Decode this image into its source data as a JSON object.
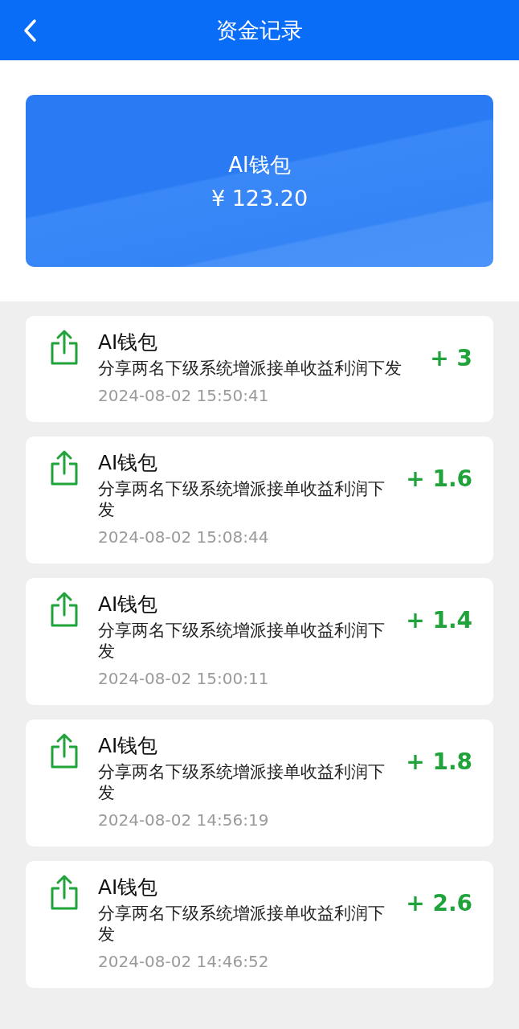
{
  "header": {
    "title": "资金记录"
  },
  "wallet": {
    "name": "AI钱包",
    "balance": "¥ 123.20"
  },
  "records": [
    {
      "name": "AI钱包",
      "description": "分享两名下级系统增派接单收益利润下发",
      "amount": "+ 3",
      "time": "2024-08-02 15:50:41"
    },
    {
      "name": "AI钱包",
      "description": "分享两名下级系统增派接单收益利润下发",
      "amount": "+ 1.6",
      "time": "2024-08-02 15:08:44"
    },
    {
      "name": "AI钱包",
      "description": "分享两名下级系统增派接单收益利润下发",
      "amount": "+ 1.4",
      "time": "2024-08-02 15:00:11"
    },
    {
      "name": "AI钱包",
      "description": "分享两名下级系统增派接单收益利润下发",
      "amount": "+ 1.8",
      "time": "2024-08-02 14:56:19"
    },
    {
      "name": "AI钱包",
      "description": "分享两名下级系统增派接单收益利润下发",
      "amount": "+ 2.6",
      "time": "2024-08-02 14:46:52"
    }
  ]
}
